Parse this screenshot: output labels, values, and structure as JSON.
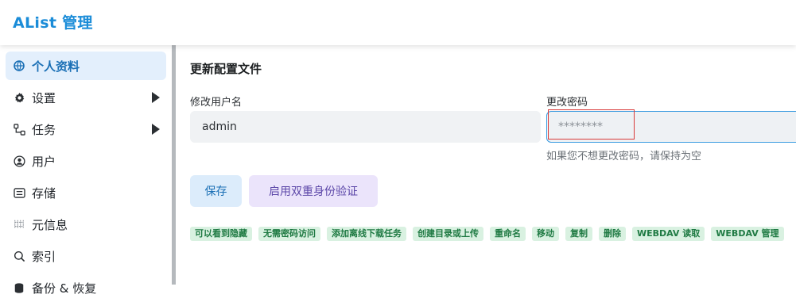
{
  "app": {
    "title": "AList 管理"
  },
  "sidebar": {
    "items": [
      {
        "label": "个人资料",
        "icon": "globe-icon",
        "active": true
      },
      {
        "label": "设置",
        "icon": "gear-icon",
        "expandable": true
      },
      {
        "label": "任务",
        "icon": "tasks-icon",
        "expandable": true
      },
      {
        "label": "用户",
        "icon": "user-circle-icon"
      },
      {
        "label": "存储",
        "icon": "storage-icon"
      },
      {
        "label": "元信息",
        "icon": "meta-icon"
      },
      {
        "label": "索引",
        "icon": "search-icon"
      },
      {
        "label": "备份 & 恢复",
        "icon": "database-icon"
      }
    ]
  },
  "main": {
    "section_title": "更新配置文件",
    "username": {
      "label": "修改用户名",
      "value": "admin"
    },
    "password": {
      "label": "更改密码",
      "placeholder": "********",
      "hint": "如果您不想更改密码，请保持为空"
    },
    "buttons": {
      "save": "保存",
      "enable_2fa": "启用双重身份验证"
    },
    "permissions": [
      "可以看到隐藏",
      "无需密码访问",
      "添加离线下载任务",
      "创建目录或上传",
      "重命名",
      "移动",
      "复制",
      "删除",
      "WEBDAV 读取",
      "WEBDAV 管理"
    ]
  },
  "colors": {
    "accent": "#1a8cd8",
    "active_bg": "#e3effc",
    "tag_bg": "#d9f1e1",
    "tag_text": "#1f7a43"
  }
}
